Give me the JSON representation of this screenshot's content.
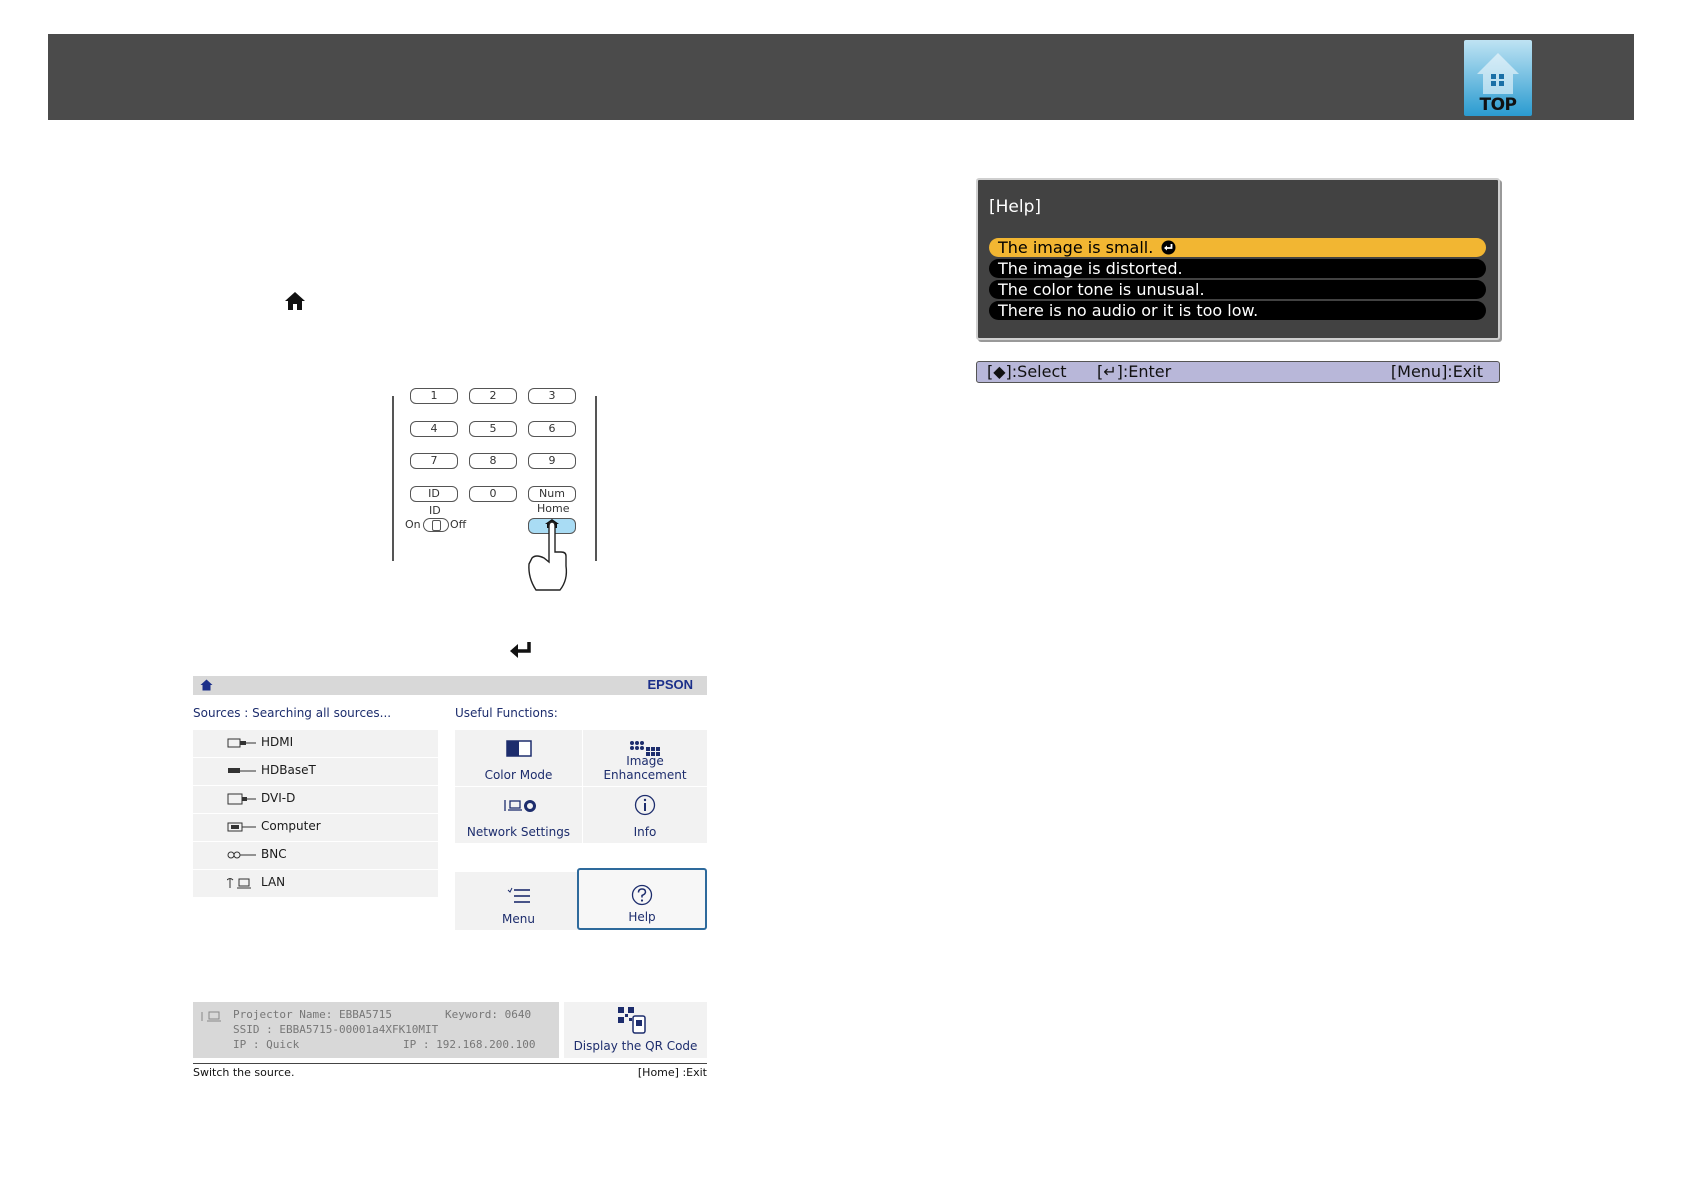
{
  "header": {
    "top_button_label": "TOP"
  },
  "remote": {
    "keys": [
      "1",
      "2",
      "3",
      "4",
      "5",
      "6",
      "7",
      "8",
      "9",
      "ID",
      "0",
      "Num"
    ],
    "home_label": "Home",
    "id_switch_label": "ID",
    "switch_on": "On",
    "switch_off": "Off"
  },
  "home_screen": {
    "brand": "EPSON",
    "sources_label": "Sources :  Searching all sources...",
    "functions_label": "Useful Functions:",
    "sources": [
      "HDMI",
      "HDBaseT",
      "DVI-D",
      "Computer",
      "BNC",
      "LAN"
    ],
    "functions": {
      "color_mode": "Color Mode",
      "image_enhancement": "Image Enhancement",
      "network_settings": "Network Settings",
      "info": "Info",
      "menu": "Menu",
      "help": "Help"
    },
    "info": {
      "projector_name": "Projector Name: EBBA5715",
      "keyword": "Keyword: 0640",
      "ssid": "SSID : EBBA5715-00001a4XFK10MIT",
      "ip_wireless": "IP : Quick",
      "ip_wired": "IP : 192.168.200.100"
    },
    "qr_label": "Display the QR Code",
    "footer_left": "Switch the source.",
    "footer_right": "[Home] :Exit"
  },
  "help_window": {
    "title": "[Help]",
    "options": [
      "The image is small.",
      "The image is distorted.",
      "The color tone is unusual.",
      "There is no audio or it is too low."
    ],
    "selected_index": 0,
    "bar_select": "[◆]:Select",
    "bar_enter": "[↵]:Enter",
    "bar_exit": "[Menu]:Exit"
  },
  "colors": {
    "header": "#4b4b4b",
    "selected_option": "#f2b632",
    "help_button_border": "#2e6a9c",
    "brand": "#1b2f8a"
  }
}
